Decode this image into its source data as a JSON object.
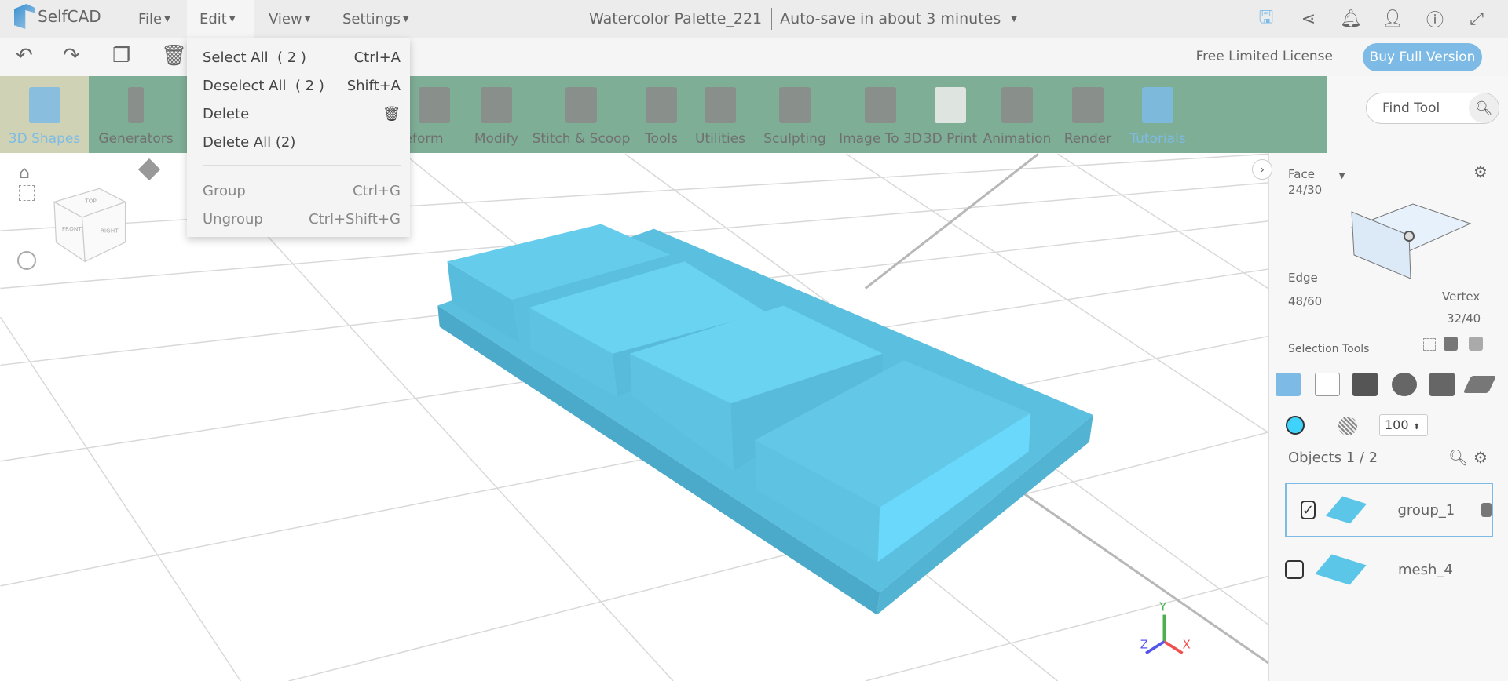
{
  "app": {
    "logo": "SelfCAD",
    "menus": [
      "File",
      "Edit",
      "View",
      "Settings"
    ],
    "document_title": "Watercolor Palette_221",
    "autosave": "Auto-save in about 3 minutes"
  },
  "header_icons": [
    "save-icon",
    "share-icon",
    "bell-icon",
    "user-icon",
    "info-icon",
    "fullscreen-icon"
  ],
  "toolbar2": {
    "license": "Free Limited License",
    "buy": "Buy Full Version"
  },
  "tools": [
    "3D Shapes",
    "Generators",
    "Deform",
    "Modify",
    "Stitch & Scoop",
    "Tools",
    "Utilities",
    "Sculpting",
    "Image To 3D",
    "3D Print",
    "Animation",
    "Render",
    "Tutorials"
  ],
  "find_tool": {
    "placeholder": "Find Tool"
  },
  "edit_menu": {
    "items": [
      {
        "label": "Select All  ( 2 )",
        "shortcut": "Ctrl+A"
      },
      {
        "label": "Deselect All  ( 2 )",
        "shortcut": "Shift+A"
      },
      {
        "label": "Delete",
        "shortcut": ""
      },
      {
        "label": "Delete All (2)",
        "shortcut": ""
      },
      {
        "label": "Group",
        "shortcut": "Ctrl+G"
      },
      {
        "label": "Ungroup",
        "shortcut": "Ctrl+Shift+G"
      }
    ]
  },
  "nav_cube": {
    "top": "TOP",
    "front": "FRONT",
    "right": "RIGHT"
  },
  "axes": {
    "x": "X",
    "y": "Y",
    "z": "Z"
  },
  "panel": {
    "face_label": "Face",
    "face_count": "24/30",
    "edge_label": "Edge",
    "edge_count": "48/60",
    "vertex_label": "Vertex",
    "vertex_count": "32/40",
    "selection_tools": "Selection Tools",
    "opacity": "100",
    "color": "#3fd3fb",
    "objects_label": "Objects 1 / 2",
    "objects": [
      {
        "name": "group_1",
        "checked": true
      },
      {
        "name": "mesh_4",
        "checked": false
      }
    ]
  }
}
